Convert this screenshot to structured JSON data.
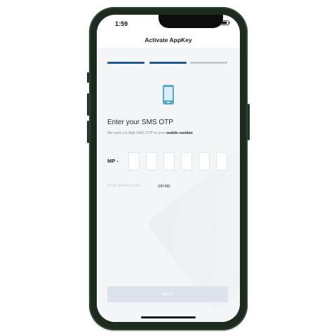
{
  "status": {
    "time": "1:59"
  },
  "nav": {
    "title": "Activate AppKey"
  },
  "steps": {
    "total": 3,
    "completed": 2
  },
  "otp": {
    "title": "Enter your SMS OTP",
    "subtitle_prefix": "We sent a 6-digit SMS OTP to your ",
    "subtitle_bold": "mobile number",
    "prefix_label": "MP -",
    "digits": [
      "",
      "",
      "",
      "",
      "",
      ""
    ],
    "resend_label": "Send another code",
    "timer": "(00:58)"
  },
  "next_button": {
    "label": "Next"
  },
  "colors": {
    "accent": "#1f5a98",
    "icon": "#5aa7c9",
    "button_disabled": "#dde3ec",
    "step_inactive": "#c7c9cc"
  }
}
